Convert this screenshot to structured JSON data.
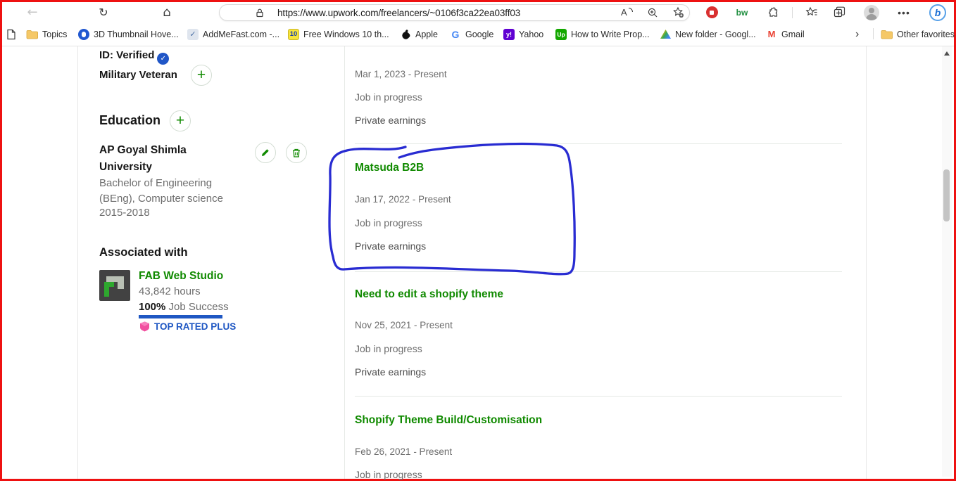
{
  "browser": {
    "url": "https://www.upwork.com/freelancers/~0106f3ca22ea03ff03",
    "extension_bw_label": "bw",
    "bing_badge": "b",
    "bookmarks": [
      {
        "label": "Topics"
      },
      {
        "label": "3D Thumbnail Hove..."
      },
      {
        "label": "AddMeFast.com -..."
      },
      {
        "label": "Free Windows 10 th..."
      },
      {
        "label": "Apple"
      },
      {
        "label": "Google"
      },
      {
        "label": "Yahoo"
      },
      {
        "label": "How to Write Prop..."
      },
      {
        "label": "New folder - Googl..."
      },
      {
        "label": "Gmail"
      }
    ],
    "win10_badge": "10",
    "yahoo_badge": "y!",
    "upwork_badge": "Up",
    "gmail_badge": "M",
    "google_badge": "G",
    "chevron": "›",
    "other_favorites": "Other favorites"
  },
  "sidebar": {
    "id_verified": "ID: Verified",
    "verified_check": "✓",
    "military_veteran": "Military Veteran",
    "plus": "+",
    "education_heading": "Education",
    "education": {
      "school": "AP Goyal Shimla University",
      "degree": "Bachelor of Engineering (BEng), Computer science",
      "years": "2015-2018"
    },
    "associated": {
      "heading": "Associated with",
      "agency": "FAB Web Studio",
      "hours": "43,842 hours",
      "job_success_pct": "100%",
      "job_success_label": "Job Success",
      "top_rated_badge": "TOP RATED PLUS"
    }
  },
  "work_history": {
    "entries": [
      {
        "title": "",
        "date": "Mar 1, 2023 - Present",
        "status": "Job in progress",
        "earnings": "Private earnings"
      },
      {
        "title": "Matsuda B2B",
        "date": "Jan 17, 2022 - Present",
        "status": "Job in progress",
        "earnings": "Private earnings"
      },
      {
        "title": "Need to edit a shopify theme",
        "date": "Nov 25, 2021 - Present",
        "status": "Job in progress",
        "earnings": "Private earnings"
      },
      {
        "title": "Shopify Theme Build/Customisation",
        "date": "Feb 26, 2021 - Present",
        "status": "Job in progress",
        "earnings": ""
      }
    ]
  },
  "colors": {
    "upwork_green": "#108a00",
    "job_success_bar": "#1f57c3",
    "top_rated_text": "#1f57c3",
    "top_rated_shield": "#f150a0",
    "annotation_ink": "#2023d0",
    "screenshot_border": "#ee1111",
    "verified_blue": "#2056c7"
  }
}
